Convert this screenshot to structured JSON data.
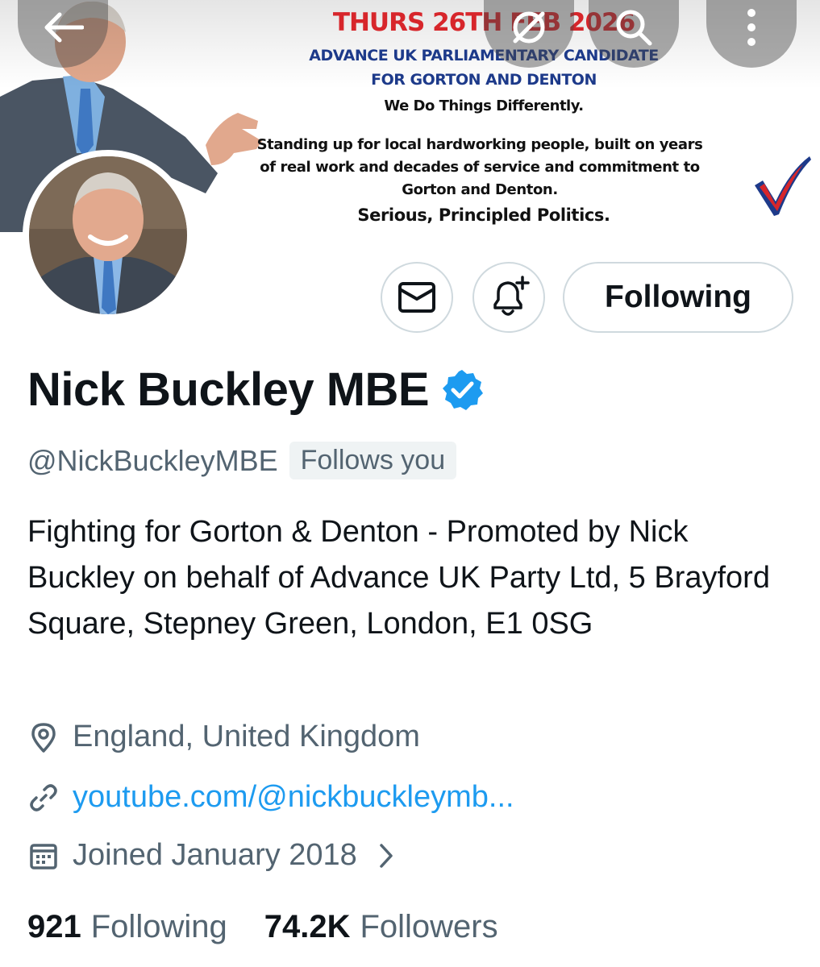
{
  "banner": {
    "date": "THURS 26TH FEB 2026",
    "candidate_line": "ADVANCE UK PARLIAMENTARY CANDIDATE",
    "constituency_line": "FOR GORTON AND DENTON",
    "motto": "We Do Things Differently.",
    "description": "Standing up for local hardworking people, built on years of real work and decades of service and commitment to Gorton and Denton.",
    "tagline": "Serious, Principled Politics."
  },
  "actions": {
    "following_label": "Following"
  },
  "profile": {
    "display_name": "Nick Buckley MBE",
    "handle": "@NickBuckleyMBE",
    "follows_you": "Follows you",
    "bio": "Fighting for Gorton & Denton - Promoted by Nick Buckley on behalf of Advance UK Party Ltd, 5 Brayford Square, Stepney Green, London, E1 0SG",
    "location": "England, United Kingdom",
    "website": "youtube.com/@nickbuckleymb...",
    "joined": "Joined January 2018"
  },
  "stats": {
    "following_count": "921",
    "following_label": "Following",
    "followers_count": "74.2K",
    "followers_label": "Followers"
  },
  "colors": {
    "accent": "#1d9bf0",
    "secondary_text": "#536471",
    "primary_text": "#0f1419",
    "banner_red": "#d7262b",
    "banner_blue": "#1d3a8a"
  },
  "icons": [
    "back-arrow-icon",
    "grok-icon",
    "search-icon",
    "more-vertical-icon",
    "mail-icon",
    "bell-plus-icon",
    "verified-badge-icon",
    "location-pin-icon",
    "link-icon",
    "calendar-icon",
    "chevron-right-icon"
  ]
}
